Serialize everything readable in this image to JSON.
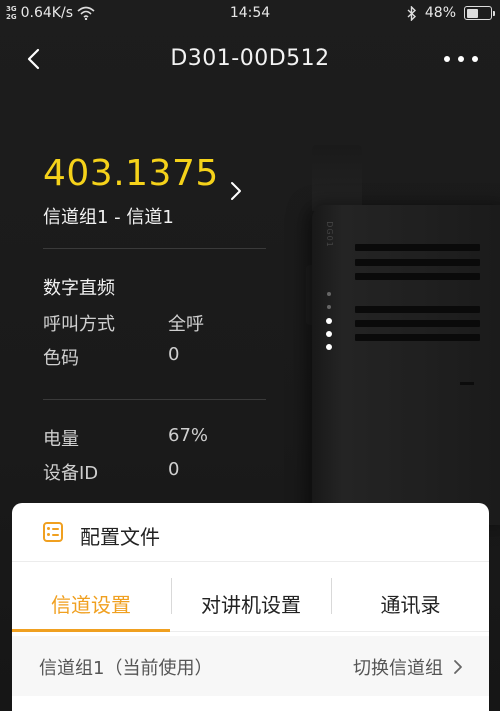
{
  "status_bar": {
    "net_top": "3G",
    "net_bottom": "2G",
    "speed": "0.64K/s",
    "time": "14:54",
    "battery": "48%",
    "battery_level": 0.48
  },
  "nav": {
    "title": "D301-00D512"
  },
  "device_info": {
    "frequency": "403.1375",
    "channel": "信道组1 - 信道1",
    "mode": "数字直频",
    "call_mode_label": "呼叫方式",
    "call_mode_value": "全呼",
    "color_code_label": "色码",
    "color_code_value": "0",
    "battery_label": "电量",
    "battery_value": "67%",
    "device_id_label": "设备ID",
    "device_id_value": "0"
  },
  "device_image": {
    "brand": "DG01"
  },
  "sheet": {
    "title": "配置文件",
    "tabs": [
      {
        "label": "信道设置",
        "active": true
      },
      {
        "label": "对讲机设置",
        "active": false
      },
      {
        "label": "通讯录",
        "active": false
      }
    ],
    "group_name": "信道组1（当前使用）",
    "switch_label": "切换信道组"
  },
  "colors": {
    "accent": "#f0a020",
    "frequency": "#f5d21a",
    "background": "#1b1b1b"
  }
}
